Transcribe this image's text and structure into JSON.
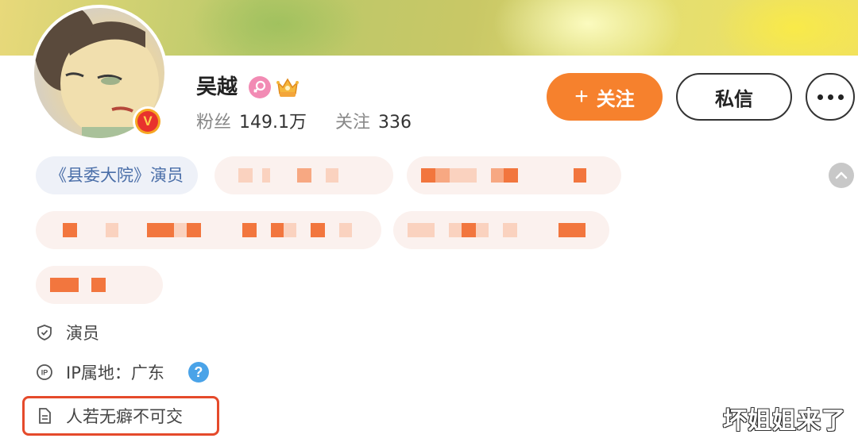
{
  "profile": {
    "name": "吴越",
    "stats": {
      "fans_label": "粉丝",
      "fans_value": "149.1万",
      "following_label": "关注",
      "following_value": "336"
    },
    "verified_badge": "V"
  },
  "actions": {
    "follow_plus": "+",
    "follow_label": "关注",
    "message_label": "私信"
  },
  "tags": {
    "first": "《县委大院》演员"
  },
  "info": {
    "occupation": "演员",
    "ip_location": "IP属地：广东",
    "help_symbol": "?",
    "bio": "人若无癖不可交"
  },
  "watermark": "坏姐姐来了",
  "colors": {
    "accent_orange": "#f6812d",
    "link_blue": "#4a6ea8",
    "highlight_red": "#e54a2b",
    "help_blue": "#4aa3e8"
  },
  "icons": {
    "gender": "female-icon",
    "vip": "vip-crown-icon",
    "occupation": "shield-check-icon",
    "ip": "ip-icon",
    "bio": "document-icon",
    "collapse": "chevron-up-icon"
  }
}
